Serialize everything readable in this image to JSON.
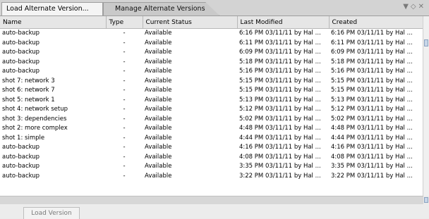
{
  "tabs": [
    {
      "label": "Load Alternate Version..."
    },
    {
      "label": "Manage Alternate Versions"
    }
  ],
  "tab_controls": {
    "menu_icon": "▼",
    "float_icon": "◇",
    "close_icon": "✕"
  },
  "table": {
    "headers": {
      "name": "Name",
      "type": "Type",
      "status": "Current Status",
      "modified": "Last Modified",
      "created": "Created"
    },
    "rows": [
      [
        "auto-backup",
        "-",
        "Available",
        "6:16 PM 03/11/11 by Hal ...",
        "6:16 PM 03/11/11 by Hal ..."
      ],
      [
        "auto-backup",
        "-",
        "Available",
        "6:11 PM 03/11/11 by Hal ...",
        "6:11 PM 03/11/11 by Hal ..."
      ],
      [
        "auto-backup",
        "-",
        "Available",
        "6:09 PM 03/11/11 by Hal ...",
        "6:09 PM 03/11/11 by Hal ..."
      ],
      [
        "auto-backup",
        "-",
        "Available",
        "5:18 PM 03/11/11 by Hal ...",
        "5:18 PM 03/11/11 by Hal ..."
      ],
      [
        "auto-backup",
        "-",
        "Available",
        "5:16 PM 03/11/11 by Hal ...",
        "5:16 PM 03/11/11 by Hal ..."
      ],
      [
        "shot 7: network 3",
        "-",
        "Available",
        "5:15 PM 03/11/11 by Hal ...",
        "5:15 PM 03/11/11 by Hal ..."
      ],
      [
        "shot 6: network 7",
        "-",
        "Available",
        "5:15 PM 03/11/11 by Hal ...",
        "5:15 PM 03/11/11 by Hal ..."
      ],
      [
        "shot 5: network 1",
        "-",
        "Available",
        "5:13 PM 03/11/11 by Hal ...",
        "5:13 PM 03/11/11 by Hal ..."
      ],
      [
        "shot 4: network setup",
        "-",
        "Available",
        "5:12 PM 03/11/11 by Hal ...",
        "5:12 PM 03/11/11 by Hal ..."
      ],
      [
        "shot 3: dependencies",
        "-",
        "Available",
        "5:02 PM 03/11/11 by Hal ...",
        "5:02 PM 03/11/11 by Hal ..."
      ],
      [
        "shot 2: more complex",
        "-",
        "Available",
        "4:48 PM 03/11/11 by Hal ...",
        "4:48 PM 03/11/11 by Hal ..."
      ],
      [
        "shot 1: simple",
        "-",
        "Available",
        "4:44 PM 03/11/11 by Hal ...",
        "4:44 PM 03/11/11 by Hal ..."
      ],
      [
        "auto-backup",
        "-",
        "Available",
        "4:16 PM 03/11/11 by Hal ...",
        "4:16 PM 03/11/11 by Hal ..."
      ],
      [
        "auto-backup",
        "-",
        "Available",
        "4:08 PM 03/11/11 by Hal ...",
        "4:08 PM 03/11/11 by Hal ..."
      ],
      [
        "auto-backup",
        "-",
        "Available",
        "3:35 PM 03/11/11 by Hal ...",
        "3:35 PM 03/11/11 by Hal ..."
      ],
      [
        "auto-backup",
        "-",
        "Available",
        "3:22 PM 03/11/11 by Hal ...",
        "3:22 PM 03/11/11 by Hal ..."
      ]
    ]
  },
  "footer": {
    "load_button": "Load Version"
  }
}
